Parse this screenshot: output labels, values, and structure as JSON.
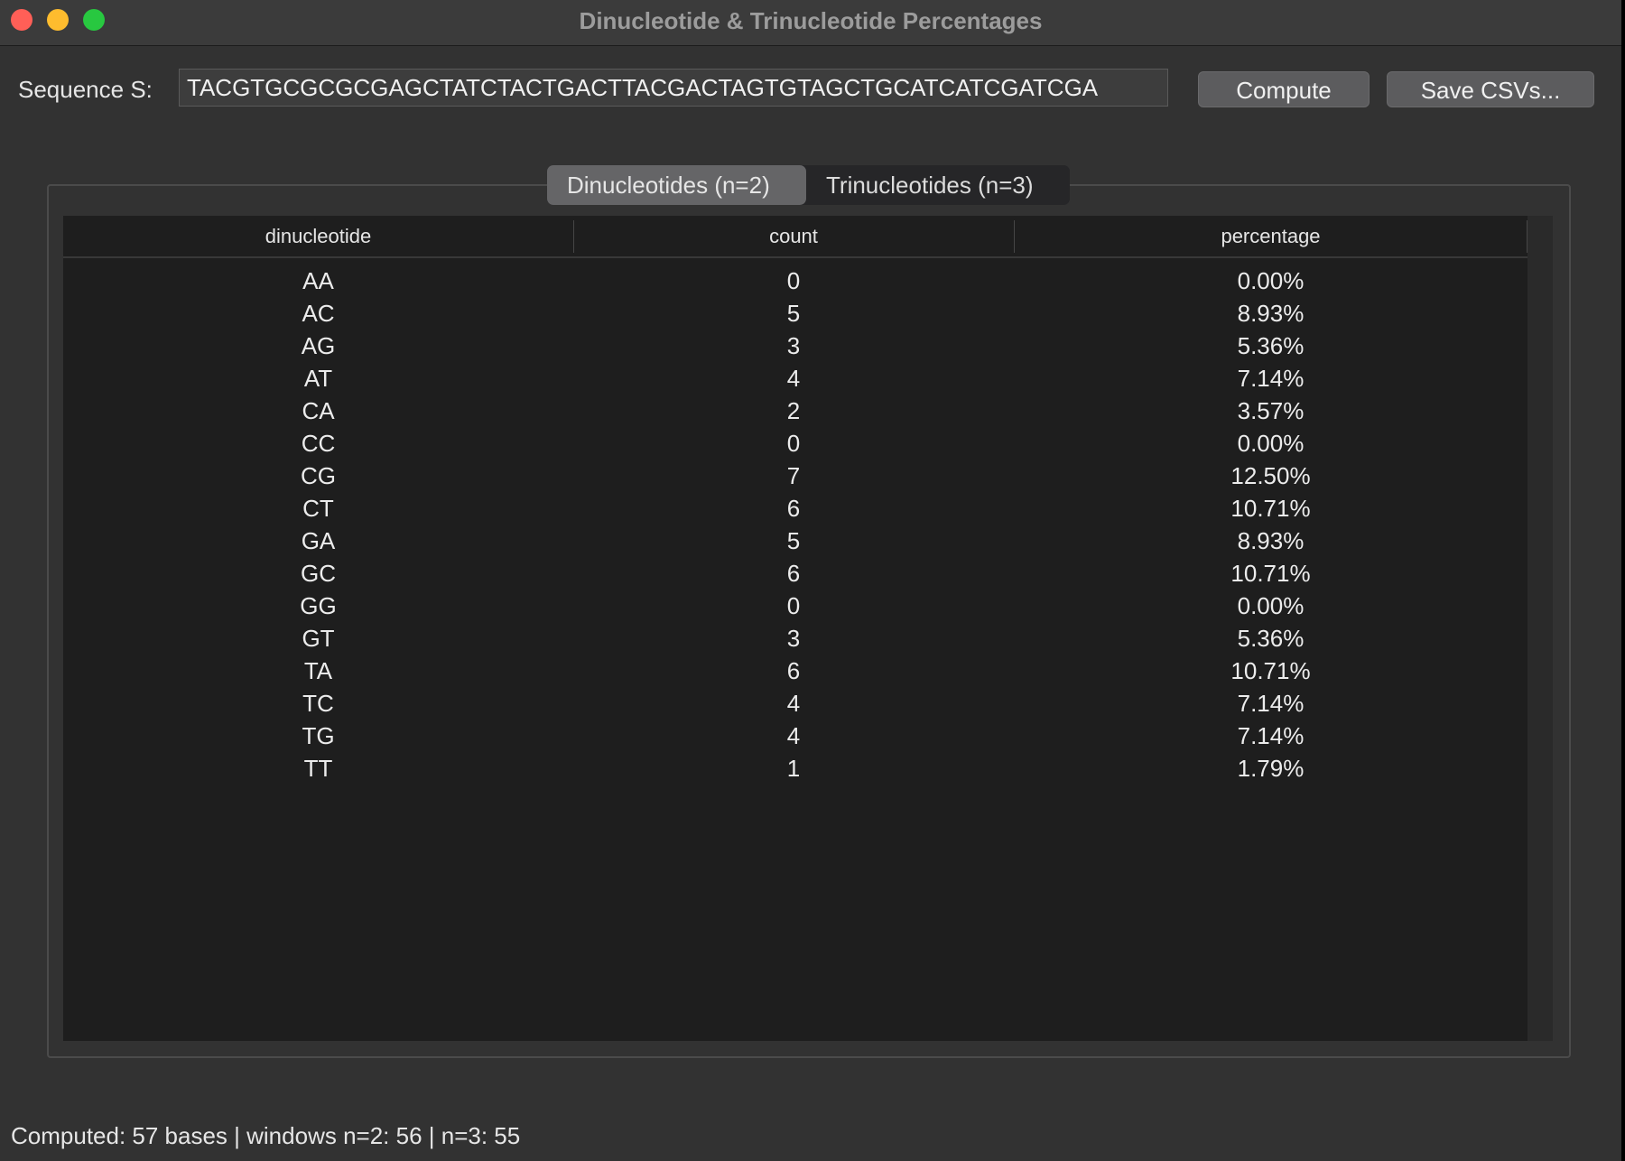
{
  "window": {
    "title": "Dinucleotide & Trinucleotide Percentages"
  },
  "sequence": {
    "label": "Sequence S:",
    "value": "TACGTGCGCGCGAGCTATCTACTGACTTACGACTAGTGTAGCTGCATCATCGATCGA"
  },
  "buttons": {
    "compute": "Compute",
    "save": "Save CSVs..."
  },
  "tabs": [
    {
      "label": "Dinucleotides (n=2)",
      "active": true
    },
    {
      "label": "Trinucleotides (n=3)",
      "active": false
    }
  ],
  "table": {
    "columns": [
      "dinucleotide",
      "count",
      "percentage"
    ],
    "rows": [
      [
        "AA",
        "0",
        "0.00%"
      ],
      [
        "AC",
        "5",
        "8.93%"
      ],
      [
        "AG",
        "3",
        "5.36%"
      ],
      [
        "AT",
        "4",
        "7.14%"
      ],
      [
        "CA",
        "2",
        "3.57%"
      ],
      [
        "CC",
        "0",
        "0.00%"
      ],
      [
        "CG",
        "7",
        "12.50%"
      ],
      [
        "CT",
        "6",
        "10.71%"
      ],
      [
        "GA",
        "5",
        "8.93%"
      ],
      [
        "GC",
        "6",
        "10.71%"
      ],
      [
        "GG",
        "0",
        "0.00%"
      ],
      [
        "GT",
        "3",
        "5.36%"
      ],
      [
        "TA",
        "6",
        "10.71%"
      ],
      [
        "TC",
        "4",
        "7.14%"
      ],
      [
        "TG",
        "4",
        "7.14%"
      ],
      [
        "TT",
        "1",
        "1.79%"
      ]
    ]
  },
  "status": "Computed: 57 bases | windows n=2: 56 | n=3: 55"
}
